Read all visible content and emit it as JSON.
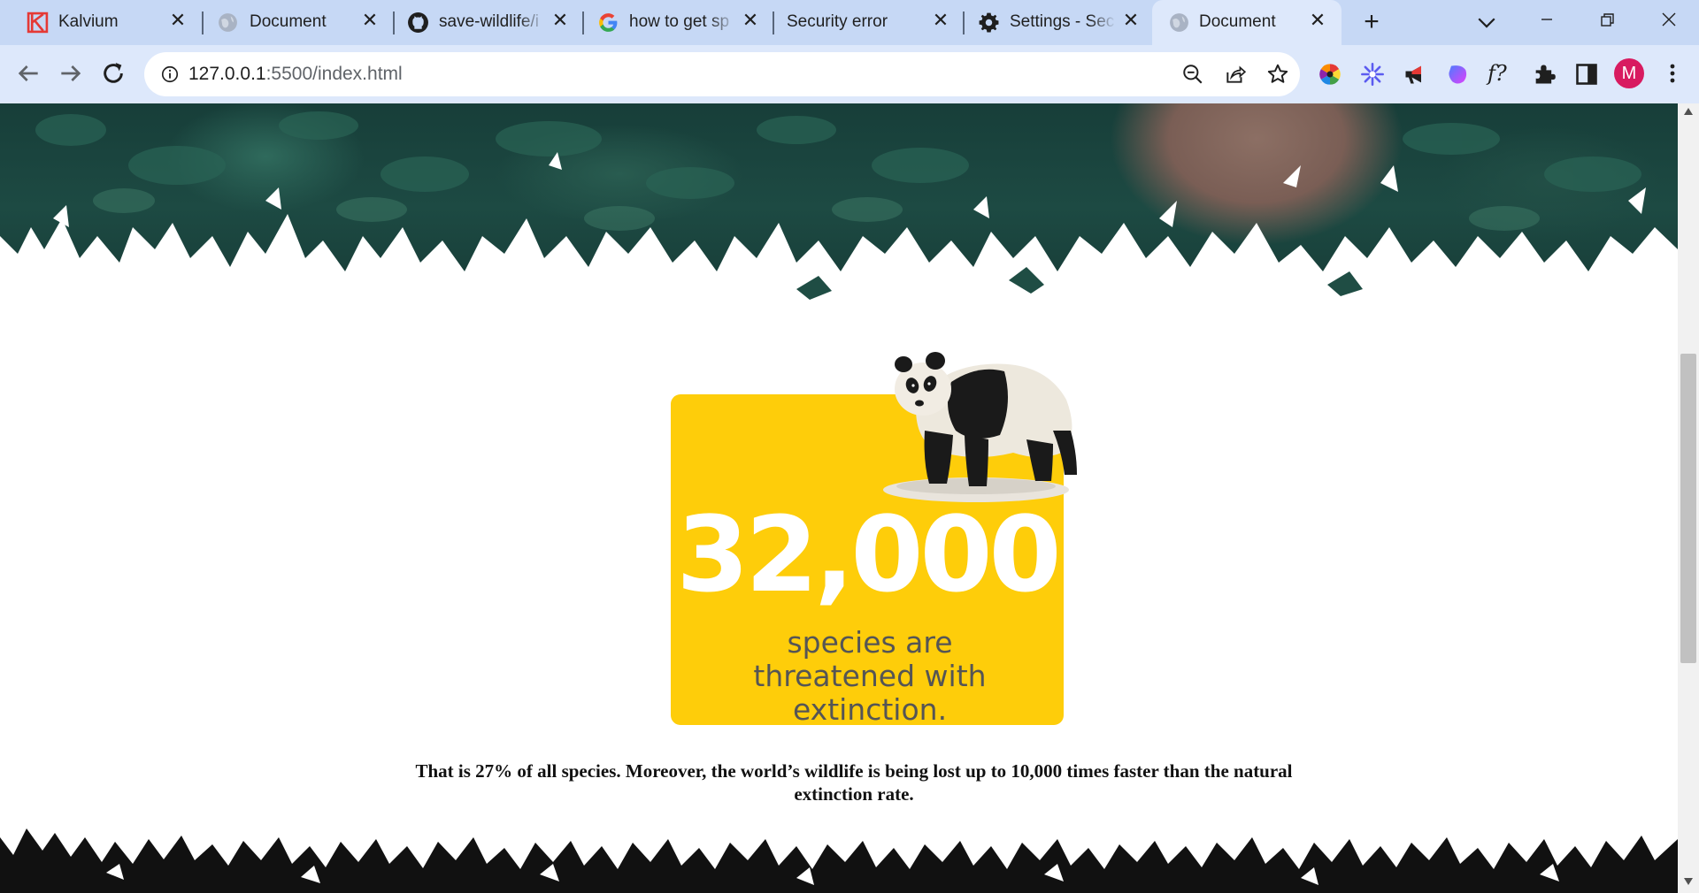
{
  "browser": {
    "tabs": [
      {
        "title": "Kalvium",
        "icon": "kalvium-logo-icon",
        "active": false
      },
      {
        "title": "Document",
        "icon": "globe-icon",
        "active": false
      },
      {
        "title": "save-wildlife/i",
        "icon": "github-icon",
        "active": false
      },
      {
        "title": "how to get sp",
        "icon": "google-icon",
        "active": false
      },
      {
        "title": "Security error",
        "icon": "none",
        "active": false
      },
      {
        "title": "Settings - Sec",
        "icon": "gear-icon",
        "active": false
      },
      {
        "title": "Document",
        "icon": "globe-icon",
        "active": true
      }
    ],
    "new_tab_label": "+",
    "close_glyph": "✕",
    "url_host": "127.0.0.1",
    "url_rest": ":5500/index.html",
    "profile_initial": "M",
    "extensions": [
      "color-wheel-icon",
      "snowflake-icon",
      "megaphone-icon",
      "gradient-blob-icon",
      "function-f-icon",
      "puzzle-piece-icon",
      "side-panel-icon"
    ],
    "extension_f_label": "f?",
    "colors": {
      "tabstrip": "#c6d8f5",
      "toolbar": "#dde8fb",
      "avatar": "#d81b60"
    }
  },
  "page": {
    "stat": {
      "number": "32,000",
      "caption": "species are threatened with extinction."
    },
    "body_text": "That is 27% of all species. Moreover, the world’s wildlife is being lost up to 10,000 times faster than the natural extinction rate.",
    "colors": {
      "card": "#fecd0a",
      "number": "#ffffff",
      "caption": "#555555",
      "hero": "#1d4a43"
    }
  }
}
